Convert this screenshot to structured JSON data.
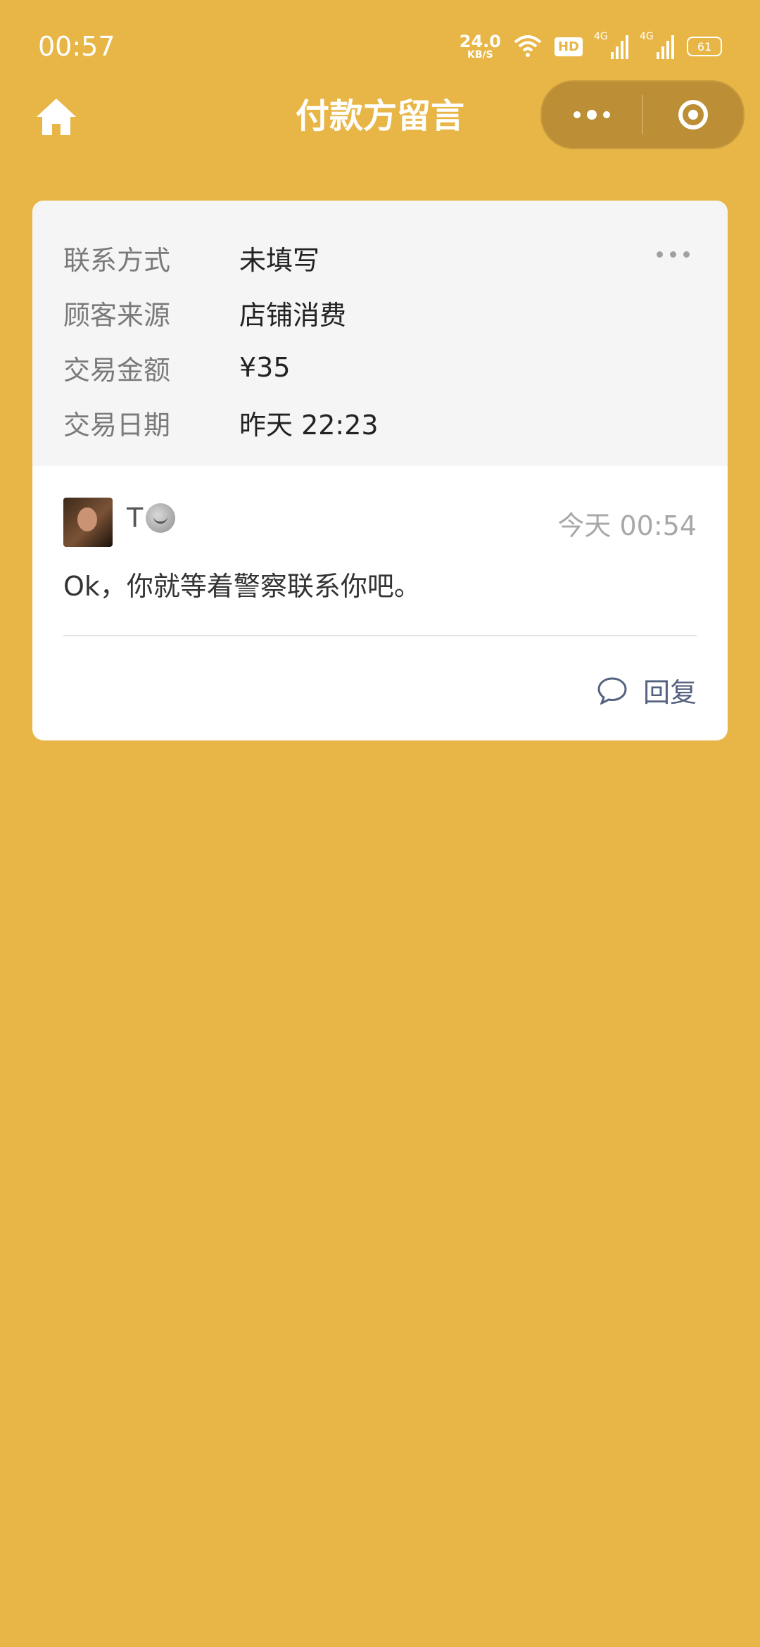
{
  "status_bar": {
    "time": "00:57",
    "net_speed_value": "24.0",
    "net_speed_unit": "KB/S",
    "hd_badge": "HD",
    "signal1_tag": "4G",
    "signal2_tag": "4G",
    "battery": "61"
  },
  "nav": {
    "title": "付款方留言",
    "home_icon": "home-icon",
    "more_icon": "more-dots-icon",
    "close_icon": "record-circle-icon"
  },
  "info": {
    "rows": [
      {
        "label": "联系方式",
        "value": "未填写"
      },
      {
        "label": "顾客来源",
        "value": "店铺消费"
      },
      {
        "label": "交易金额",
        "value": "¥35"
      },
      {
        "label": "交易日期",
        "value": "昨天 22:23"
      }
    ]
  },
  "message": {
    "user_name": "T",
    "time": "今天 00:54",
    "text": "Ok，你就等着警察联系你吧。",
    "reply_label": "回复"
  },
  "colors": {
    "background": "#E8B646",
    "card": "#FFFFFF",
    "info_bg": "#F5F5F5",
    "reply_color": "#546280"
  }
}
